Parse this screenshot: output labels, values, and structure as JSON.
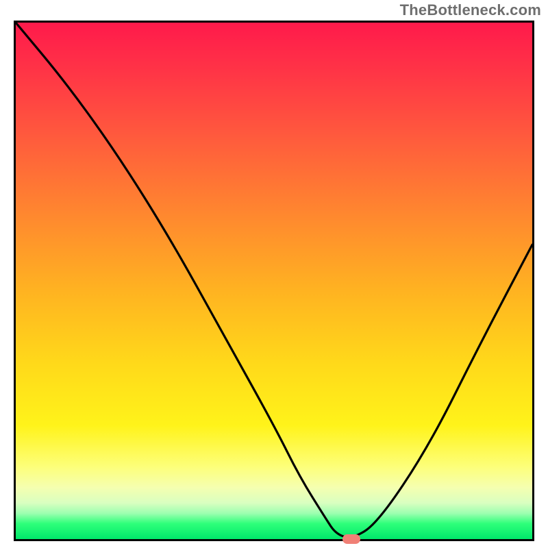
{
  "watermark": "TheBottleneck.com",
  "chart_data": {
    "type": "line",
    "title": "",
    "xlabel": "",
    "ylabel": "",
    "x_range": [
      0,
      100
    ],
    "y_range": [
      0,
      100
    ],
    "grid": false,
    "legend": false,
    "series": [
      {
        "name": "bottleneck-curve",
        "x": [
          0,
          10,
          20,
          30,
          40,
          50,
          55,
          60,
          62,
          65,
          70,
          80,
          90,
          100
        ],
        "y": [
          100,
          88,
          74,
          58,
          40,
          22,
          12,
          4,
          1,
          0,
          3,
          18,
          38,
          57
        ]
      }
    ],
    "optimal_marker": {
      "x": 65,
      "y": 0
    },
    "background_gradient": {
      "stops": [
        {
          "pos": 0,
          "color": "#ff1a4b"
        },
        {
          "pos": 22,
          "color": "#ff5a3d"
        },
        {
          "pos": 52,
          "color": "#ffb321"
        },
        {
          "pos": 78,
          "color": "#fff31a"
        },
        {
          "pos": 93,
          "color": "#d9ffc0"
        },
        {
          "pos": 100,
          "color": "#00e86b"
        }
      ]
    }
  }
}
